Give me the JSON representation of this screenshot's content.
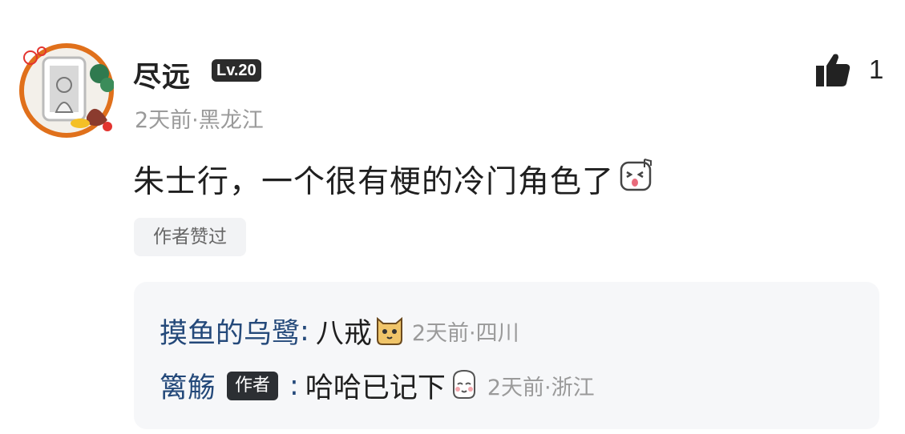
{
  "comment": {
    "username": "尽远",
    "level": "Lv.20",
    "meta": "2天前·黑龙江",
    "text": "朱士行，一个很有梗的冷门角色了",
    "author_liked": "作者赞过",
    "like_count": "1"
  },
  "replies": [
    {
      "name": "摸鱼的乌鹭",
      "colon": ":",
      "text": "八戒",
      "meta": "2天前·四川"
    },
    {
      "name": "篱觞",
      "badge": "作者",
      "colon": ":",
      "text": "哈哈已记下",
      "meta": "2天前·浙江"
    }
  ],
  "colors": {
    "reply_name": "#24497a",
    "meta_gray": "#9a9a9a",
    "reply_bg": "#f6f7f9"
  }
}
